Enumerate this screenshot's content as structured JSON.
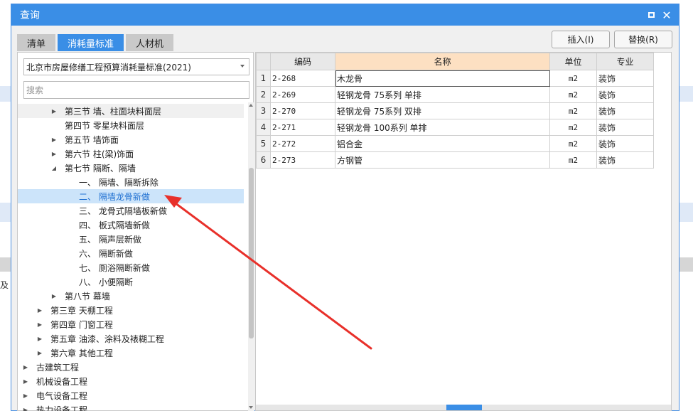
{
  "dialog": {
    "title": "查询",
    "restore_icon": "restore-icon",
    "close_glyph": "✕"
  },
  "tabs": [
    {
      "label": "清单",
      "active": false
    },
    {
      "label": "消耗量标准",
      "active": true
    },
    {
      "label": "人材机",
      "active": false
    }
  ],
  "buttons": {
    "insert": "插入(I)",
    "replace": "替换(R)"
  },
  "left": {
    "standard_select": "北京市房屋修缮工程预算消耗量标准(2021)",
    "search_placeholder": "搜索",
    "tree": [
      {
        "label": "第三节 墙、柱面块料面层",
        "indent": 2,
        "arrow": "▶",
        "state": "first-row"
      },
      {
        "label": "第四节 零星块料面层",
        "indent": 2,
        "arrow": "",
        "state": ""
      },
      {
        "label": "第五节 墙饰面",
        "indent": 2,
        "arrow": "▶",
        "state": ""
      },
      {
        "label": "第六节 柱(梁)饰面",
        "indent": 2,
        "arrow": "▶",
        "state": ""
      },
      {
        "label": "第七节 隔断、隔墙",
        "indent": 2,
        "arrow": "◢",
        "state": ""
      },
      {
        "label": "一、 隔墙、隔断拆除",
        "indent": 3,
        "arrow": "",
        "state": ""
      },
      {
        "label": "二、 隔墙龙骨新做",
        "indent": 3,
        "arrow": "",
        "state": "selected"
      },
      {
        "label": "三、 龙骨式隔墙板新做",
        "indent": 3,
        "arrow": "",
        "state": ""
      },
      {
        "label": "四、 板式隔墙新做",
        "indent": 3,
        "arrow": "",
        "state": ""
      },
      {
        "label": "五、 隔声层新做",
        "indent": 3,
        "arrow": "",
        "state": ""
      },
      {
        "label": "六、 隔断新做",
        "indent": 3,
        "arrow": "",
        "state": ""
      },
      {
        "label": "七、 厕浴隔断新做",
        "indent": 3,
        "arrow": "",
        "state": ""
      },
      {
        "label": "八、 小便隔断",
        "indent": 3,
        "arrow": "",
        "state": ""
      },
      {
        "label": "第八节 幕墙",
        "indent": 2,
        "arrow": "▶",
        "state": ""
      },
      {
        "label": "第三章 天棚工程",
        "indent": 1,
        "arrow": "▶",
        "state": ""
      },
      {
        "label": "第四章 门窗工程",
        "indent": 1,
        "arrow": "▶",
        "state": ""
      },
      {
        "label": "第五章 油漆、涂料及裱糊工程",
        "indent": 1,
        "arrow": "▶",
        "state": ""
      },
      {
        "label": "第六章 其他工程",
        "indent": 1,
        "arrow": "▶",
        "state": ""
      },
      {
        "label": "古建筑工程",
        "indent": 0,
        "arrow": "▶",
        "state": ""
      },
      {
        "label": "机械设备工程",
        "indent": 0,
        "arrow": "▶",
        "state": ""
      },
      {
        "label": "电气设备工程",
        "indent": 0,
        "arrow": "▶",
        "state": ""
      },
      {
        "label": "热力设备工程",
        "indent": 0,
        "arrow": "▶",
        "state": ""
      }
    ]
  },
  "table": {
    "headers": [
      "",
      "编码",
      "名称",
      "单位",
      "专业"
    ],
    "rows": [
      {
        "idx": "1",
        "code": "2-268",
        "name": "木龙骨",
        "unit": "m2",
        "major": "装饰"
      },
      {
        "idx": "2",
        "code": "2-269",
        "name": "轻钢龙骨 75系列 单排",
        "unit": "m2",
        "major": "装饰"
      },
      {
        "idx": "3",
        "code": "2-270",
        "name": "轻钢龙骨 75系列 双排",
        "unit": "m2",
        "major": "装饰"
      },
      {
        "idx": "4",
        "code": "2-271",
        "name": "轻钢龙骨 100系列 单排",
        "unit": "m2",
        "major": "装饰"
      },
      {
        "idx": "5",
        "code": "2-272",
        "name": "铝合金",
        "unit": "m2",
        "major": "装饰"
      },
      {
        "idx": "6",
        "code": "2-273",
        "name": "方钢管",
        "unit": "m2",
        "major": "装饰"
      }
    ]
  },
  "background": {
    "edge_text": "及"
  },
  "colors": {
    "accent": "#3a8ee6",
    "selected_row": "#cce4fa",
    "name_header": "#fde0c2",
    "arrow": "#e8302a"
  }
}
